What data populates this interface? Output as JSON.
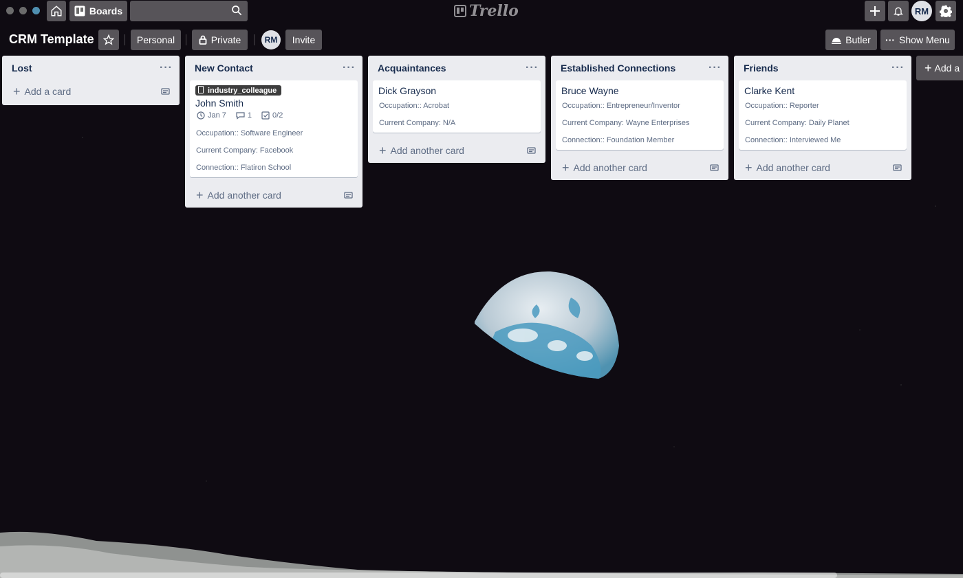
{
  "app": {
    "logo_text": "Trello"
  },
  "topbar": {
    "boards_label": "Boards",
    "search_placeholder": "",
    "avatar_initials": "RM"
  },
  "board": {
    "title": "CRM Template",
    "personal_label": "Personal",
    "private_label": "Private",
    "member_initials": "RM",
    "invite_label": "Invite",
    "butler_label": "Butler",
    "show_menu_label": "Show Menu"
  },
  "lists": [
    {
      "title": "Lost",
      "add_label": "Add a card",
      "cards": []
    },
    {
      "title": "New Contact",
      "add_label": "Add another card",
      "cards": [
        {
          "label": "industry_colleague",
          "title": "John Smith",
          "due": "Jan 7",
          "comments": "1",
          "checklist": "0/2",
          "fields": [
            "Occupation:: Software Engineer",
            "Current Company: Facebook",
            "Connection:: Flatiron School"
          ]
        }
      ]
    },
    {
      "title": "Acquaintances",
      "add_label": "Add another card",
      "cards": [
        {
          "title": "Dick Grayson",
          "fields": [
            "Occupation:: Acrobat",
            "Current Company: N/A"
          ]
        }
      ]
    },
    {
      "title": "Established Connections",
      "add_label": "Add another card",
      "cards": [
        {
          "title": "Bruce Wayne",
          "fields": [
            "Occupation:: Entrepreneur/Inventor",
            "Current Company: Wayne Enterprises",
            "Connection:: Foundation Member"
          ]
        }
      ]
    },
    {
      "title": "Friends",
      "add_label": "Add another card",
      "cards": [
        {
          "title": "Clarke Kent",
          "fields": [
            "Occupation:: Reporter",
            "Current Company: Daily Planet",
            "Connection:: Interviewed Me"
          ]
        }
      ]
    }
  ],
  "add_list_label": "Add a",
  "colors": {
    "label_bg": "#3d3d3d",
    "list_bg": "#ebecf0",
    "accent": "#0079bf"
  }
}
